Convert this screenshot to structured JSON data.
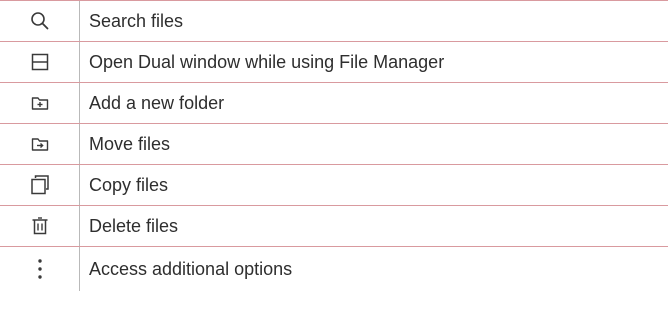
{
  "icon_table": {
    "rows": [
      {
        "icon": "search-icon",
        "label": "Search files"
      },
      {
        "icon": "dual-window-icon",
        "label": "Open Dual window while using File Manager"
      },
      {
        "icon": "add-folder-icon",
        "label": "Add a new folder"
      },
      {
        "icon": "move-files-icon",
        "label": "Move files"
      },
      {
        "icon": "copy-files-icon",
        "label": "Copy files"
      },
      {
        "icon": "delete-files-icon",
        "label": "Delete files"
      },
      {
        "icon": "more-options-icon",
        "label": "Access additional options"
      }
    ]
  },
  "colors": {
    "row_divider": "#d99a9f",
    "column_divider": "#b9b9b9",
    "icon": "#3a3a3a",
    "text": "#2e2e2e"
  }
}
